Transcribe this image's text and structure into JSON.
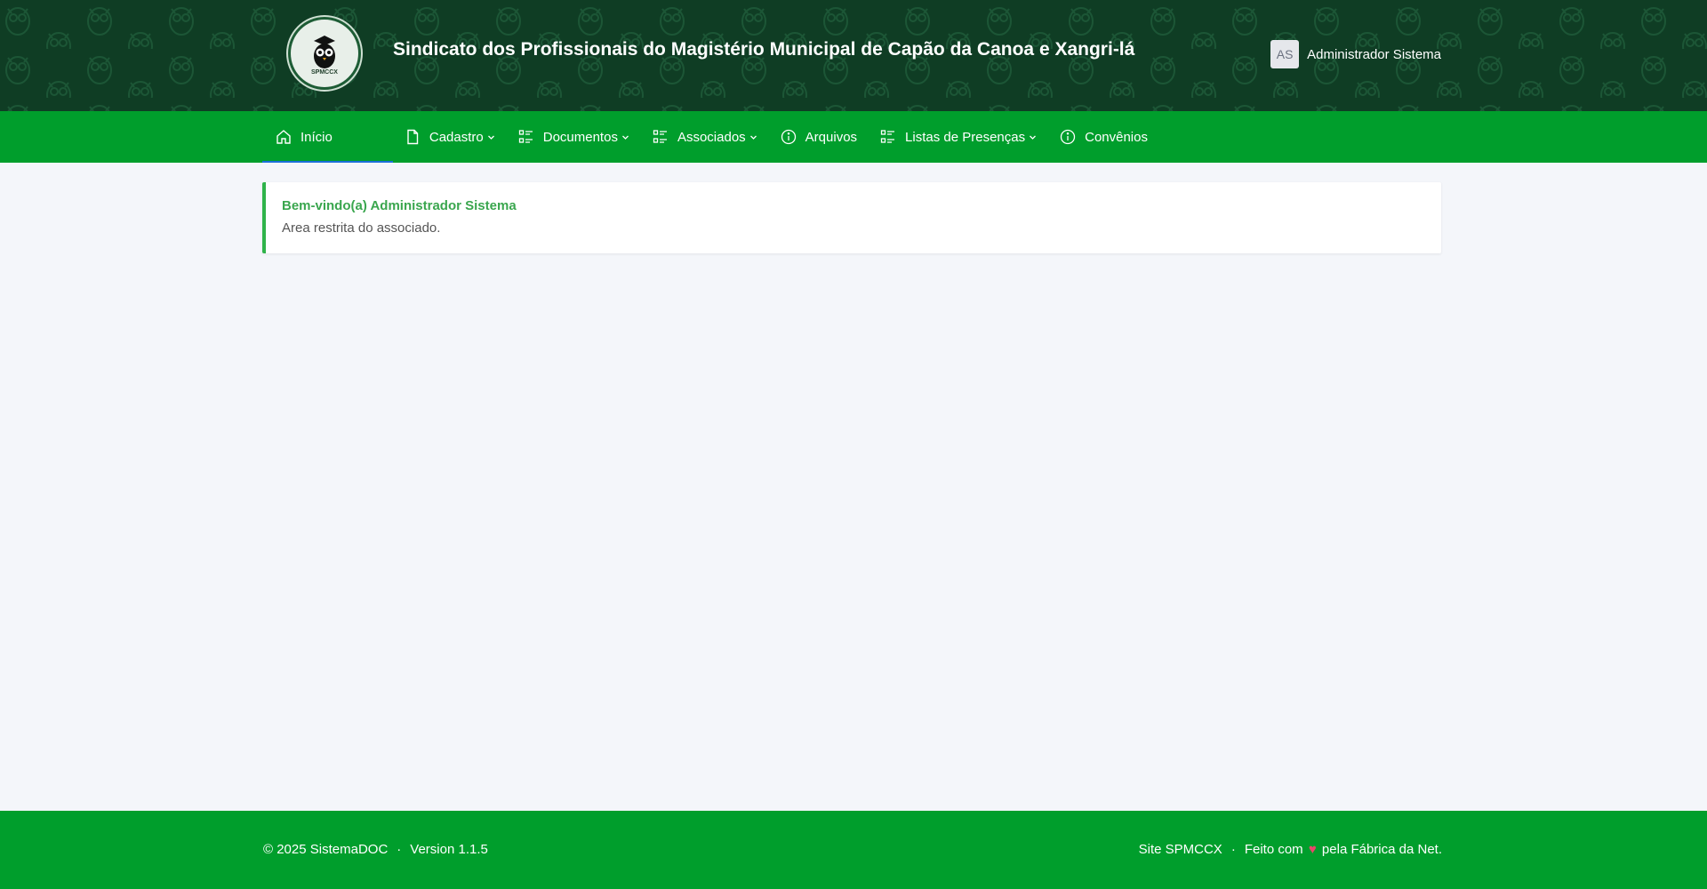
{
  "header": {
    "title": "Sindicato dos Profissionais do Magistério Municipal de Capão da Canoa e Xangri-lá",
    "logo_text": "SPMCCX",
    "user_initials": "AS",
    "user_name": "Administrador Sistema"
  },
  "nav": {
    "items": [
      {
        "label": "Início",
        "icon": "home-icon"
      },
      {
        "label": "Cadastro",
        "icon": "document-icon"
      },
      {
        "label": "Documentos",
        "icon": "list-icon"
      },
      {
        "label": "Associados",
        "icon": "list-icon"
      },
      {
        "label": "Arquivos",
        "icon": "info-icon"
      },
      {
        "label": "Listas de Presenças",
        "icon": "list-icon"
      },
      {
        "label": "Convênios",
        "icon": "info-icon"
      }
    ]
  },
  "welcome": {
    "title": "Bem-vindo(a) Administrador Sistema",
    "text": "Area restrita do associado."
  },
  "footer": {
    "copyright": "© 2025 SistemaDOC",
    "version": "Version 1.1.5",
    "site_link": "Site SPMCCX",
    "made_with": "Feito com",
    "heart": "♥",
    "made_by": "pela Fábrica da Net."
  },
  "colors": {
    "header_bg": "#0f3d24",
    "nav_bg": "#009e2c",
    "accent": "#2fb34a",
    "active_underline": "#1b6fd8",
    "heart": "#e8476b"
  }
}
